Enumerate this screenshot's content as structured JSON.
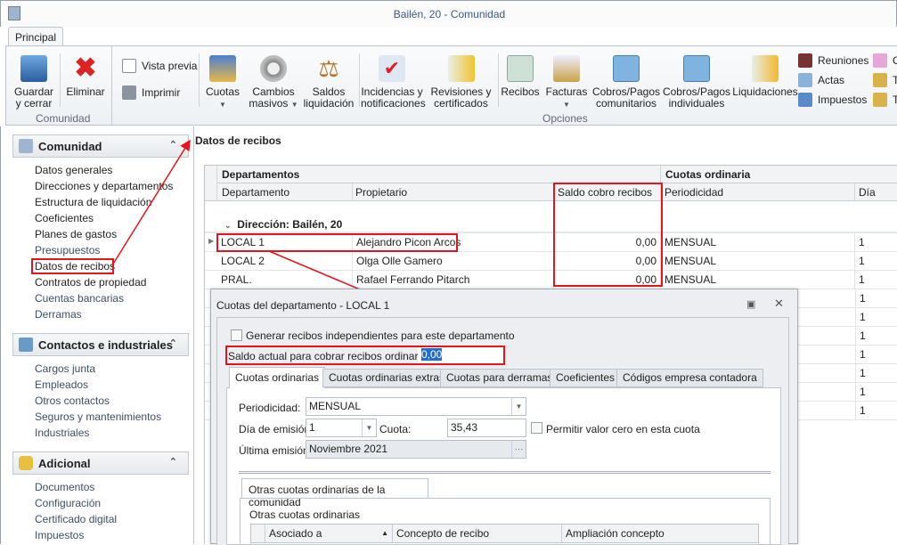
{
  "window": {
    "title": "Bailén, 20 - Comunidad"
  },
  "ribbon": {
    "tab": "Principal",
    "groups": {
      "comunidad": "Comunidad",
      "opciones": "Opciones"
    },
    "buttons": {
      "guardar": "Guardar y cerrar",
      "eliminar": "Eliminar",
      "vista_previa": "Vista previa",
      "imprimir": "Imprimir",
      "cuotas": "Cuotas",
      "cambios": "Cambios masivos",
      "saldos": "Saldos liquidación",
      "incidencias": "Incidencias y notificaciones",
      "revisiones": "Revisiones y certificados",
      "recibos": "Recibos",
      "facturas": "Facturas",
      "cobros_com": "Cobros/Pagos comunitarios",
      "cobros_ind": "Cobros/Pagos individuales",
      "liquidaciones": "Liquidaciones",
      "reuniones": "Reuniones",
      "actas": "Actas",
      "impuestos": "Impuestos",
      "co": "Co",
      "tr1": "Tr",
      "tr2": "Tr"
    }
  },
  "sidebar": {
    "sections": [
      {
        "title": "Comunidad",
        "items": [
          "Datos generales",
          "Direcciones y departamentos",
          "Estructura de liquidación",
          "Coeficientes",
          "Planes de gastos",
          "Presupuestos",
          "Datos de recibos",
          "Contratos de propiedad",
          "Cuentas bancarias",
          "Derramas"
        ]
      },
      {
        "title": "Contactos e industriales",
        "items": [
          "Cargos junta",
          "Empleados",
          "Otros contactos",
          "Seguros y mantenimientos",
          "Industriales"
        ]
      },
      {
        "title": "Adicional",
        "items": [
          "Documentos",
          "Configuración",
          "Certificado digital",
          "Impuestos"
        ]
      }
    ]
  },
  "main": {
    "title": "Datos de recibos",
    "bands": [
      "Departamentos",
      "Cuotas ordinaria"
    ],
    "columns": [
      "Departamento",
      "Propietario",
      "Saldo cobro recibos",
      "Periodicidad",
      "Día"
    ],
    "group": "Dirección: Bailén, 20",
    "rows": [
      {
        "dep": "LOCAL 1",
        "prop": "Alejandro Picon Arcos",
        "saldo": "0,00",
        "per": "MENSUAL",
        "dia": "1"
      },
      {
        "dep": "LOCAL 2",
        "prop": "Olga Olle Gamero",
        "saldo": "0,00",
        "per": "MENSUAL",
        "dia": "1"
      },
      {
        "dep": "PRAL.",
        "prop": "Rafael Ferrando Pitarch",
        "saldo": "0,00",
        "per": "MENSUAL",
        "dia": "1"
      }
    ],
    "hidden_rows_dia": [
      "1",
      "1",
      "1",
      "1",
      "1",
      "1",
      "1"
    ]
  },
  "dialog": {
    "title": "Cuotas del departamento - LOCAL 1",
    "generar_label": "Generar recibos independientes para este departamento",
    "saldo_label": "Saldo actual para cobrar recibos ordinarios:",
    "saldo_value": "0,00",
    "tabs": [
      "Cuotas ordinarias",
      "Cuotas ordinarias extras",
      "Cuotas para derramas",
      "Coeficientes",
      "Códigos empresa contadora"
    ],
    "periodicidad_label": "Periodicidad:",
    "periodicidad": "MENSUAL",
    "dia_label": "Día de emisión:",
    "dia": "1",
    "cuota_label": "Cuota:",
    "cuota": "35,43",
    "permitir_label": "Permitir valor cero en esta cuota",
    "ultima_label": "Última emisión:",
    "ultima": "Noviembre 2021",
    "ellipsis": "···",
    "subtab": "Otras cuotas ordinarias de la comunidad",
    "subtitle": "Otras cuotas ordinarias",
    "subcolumns": [
      "Asociado a",
      "Concepto de recibo",
      "Ampliación concepto"
    ]
  },
  "colors": {
    "annotation": "#e8141c",
    "accent": "#3b5a8a"
  }
}
